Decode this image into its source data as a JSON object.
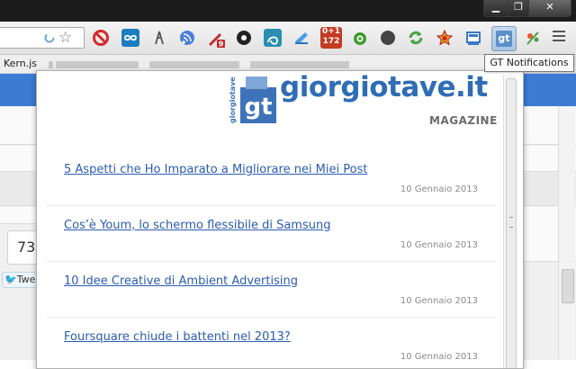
{
  "window": {
    "minimize_icon": "minimize-icon",
    "restore_icon": "restore-icon",
    "close_icon": "close-icon"
  },
  "toolbar": {
    "omnibox_icon": "loading-spinner-icon",
    "star_icon": "bookmark-star-icon",
    "extensions": [
      {
        "name": "block-icon",
        "color": "#d42a2a"
      },
      {
        "name": "infinity-icon",
        "color": "#1d7dc1"
      },
      {
        "name": "branch-icon",
        "color": "#555555"
      },
      {
        "name": "feed-icon",
        "color": "#4a7fd6"
      },
      {
        "name": "rocket-icon",
        "color": "#c22b2b"
      },
      {
        "name": "gear-icon",
        "color": "#222222"
      },
      {
        "name": "swirl-icon",
        "color": "#2a8fb0"
      },
      {
        "name": "screen-icon",
        "color": "#4aa0e6"
      },
      {
        "name": "counter-icon",
        "color": "#c43b22",
        "text": "0+1\n172"
      },
      {
        "name": "android-icon",
        "color": "#3f9b2f"
      },
      {
        "name": "circle-icon",
        "color": "#444444"
      },
      {
        "name": "refresh-icon",
        "color": "#48a347"
      },
      {
        "name": "star-badge-icon",
        "color": "#e6a21b"
      },
      {
        "name": "window-icon",
        "color": "#3a79c5"
      },
      {
        "name": "gt-icon",
        "color": "#5b8fc9"
      },
      {
        "name": "plant-icon",
        "color": "#4aa04a"
      }
    ],
    "menu_icon": "menu-icon"
  },
  "bookmarks": {
    "first_label": "Kern.js"
  },
  "background_page": {
    "counter": "73",
    "tweet_label": "Twe"
  },
  "tooltip": {
    "text": "GT Notifications"
  },
  "popup": {
    "logo_mark": "gt",
    "logo_vertical": "giorgiotave",
    "logo_text": "giorgiotave.it",
    "tagline": "MAGAZINE",
    "articles": [
      {
        "title": "5 Aspetti che Ho Imparato a Migliorare nei Miei Post",
        "date": "10 Gennaio 2013"
      },
      {
        "title": "Cos’è Youm, lo schermo flessibile di Samsung",
        "date": "10 Gennaio 2013"
      },
      {
        "title": "10 Idee Creative di Ambient Advertising",
        "date": "10 Gennaio 2013"
      },
      {
        "title": "Foursquare chiude i battenti nel 2013?",
        "date": "10 Gennaio 2013"
      }
    ]
  }
}
